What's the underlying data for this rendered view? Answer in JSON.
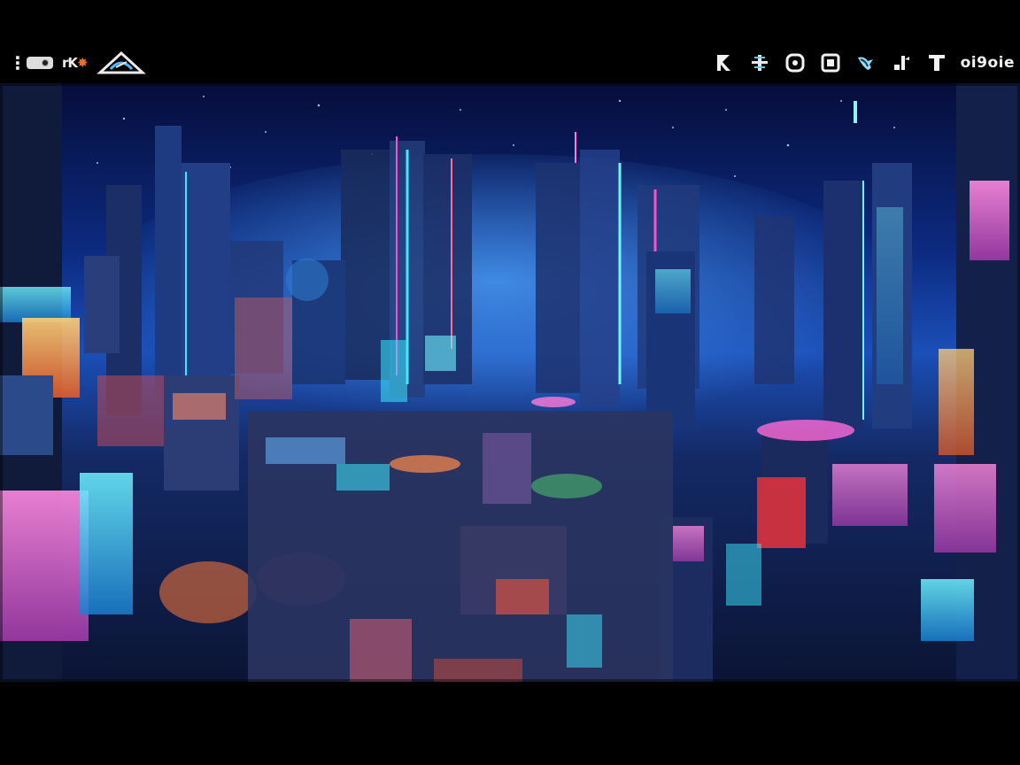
{
  "hud": {
    "left": {
      "menu_icon": "more-vertical-icon",
      "toggle_icon": "toggle-icon",
      "logo_text": "rK",
      "logo_burst": "✸",
      "emblem_icon": "emblem-icon"
    },
    "right": {
      "icons": [
        {
          "name": "k-glyph-icon"
        },
        {
          "name": "crosshair-icon"
        },
        {
          "name": "target-icon"
        },
        {
          "name": "grid-icon"
        },
        {
          "name": "wing-icon"
        },
        {
          "name": "tool-icon"
        },
        {
          "name": "banner-icon"
        }
      ],
      "counter_text": "oi9oie"
    }
  },
  "scene": {
    "type": "neon-city-skyline",
    "colors": {
      "sky_top": "#060d3a",
      "sky_mid": "#1b4fb8",
      "neon_cyan": "#3ee8ff",
      "neon_pink": "#ff4fc8",
      "neon_orange": "#ff9a3a",
      "neon_red": "#e8323a"
    }
  }
}
